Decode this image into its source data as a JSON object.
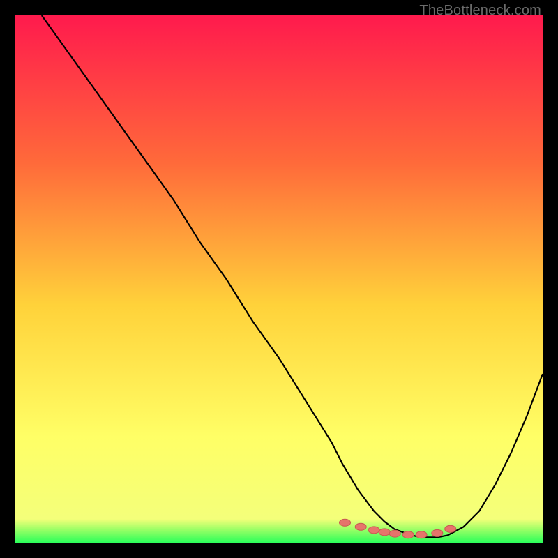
{
  "watermark": "TheBottleneck.com",
  "colors": {
    "bg": "#000000",
    "curve": "#000000",
    "marker_fill": "#e6746b",
    "marker_stroke": "#c85a52",
    "grad_top": "#ff1a4d",
    "grad_mid1": "#ff6a3a",
    "grad_mid2": "#ffd23a",
    "grad_mid3": "#ffff66",
    "grad_bottom": "#2bff5a"
  },
  "chart_data": {
    "type": "line",
    "title": "",
    "xlabel": "",
    "ylabel": "",
    "xlim": [
      0,
      100
    ],
    "ylim": [
      0,
      100
    ],
    "grid": false,
    "legend": false,
    "series": [
      {
        "name": "bottleneck-curve",
        "x": [
          5,
          10,
          15,
          20,
          25,
          30,
          35,
          40,
          45,
          50,
          55,
          60,
          62,
          65,
          68,
          70,
          72,
          74,
          76,
          78,
          80,
          82,
          85,
          88,
          91,
          94,
          97,
          100
        ],
        "y": [
          100,
          93,
          86,
          79,
          72,
          65,
          57,
          50,
          42,
          35,
          27,
          19,
          15,
          10,
          6,
          4,
          2.5,
          1.8,
          1.2,
          1.0,
          1.0,
          1.4,
          3,
          6,
          11,
          17,
          24,
          32
        ]
      }
    ],
    "markers": {
      "name": "valley-points",
      "x": [
        62.5,
        65.5,
        68,
        70,
        72,
        74.5,
        77,
        80,
        82.5
      ],
      "y": [
        3.8,
        3.0,
        2.4,
        2.0,
        1.7,
        1.5,
        1.5,
        1.8,
        2.6
      ]
    },
    "gradient_stops": [
      {
        "offset": 0.0,
        "color": "#ff1a4d"
      },
      {
        "offset": 0.28,
        "color": "#ff6a3a"
      },
      {
        "offset": 0.55,
        "color": "#ffd23a"
      },
      {
        "offset": 0.8,
        "color": "#ffff66"
      },
      {
        "offset": 0.955,
        "color": "#f4ff7a"
      },
      {
        "offset": 0.975,
        "color": "#9bff66"
      },
      {
        "offset": 1.0,
        "color": "#2bff5a"
      }
    ]
  }
}
